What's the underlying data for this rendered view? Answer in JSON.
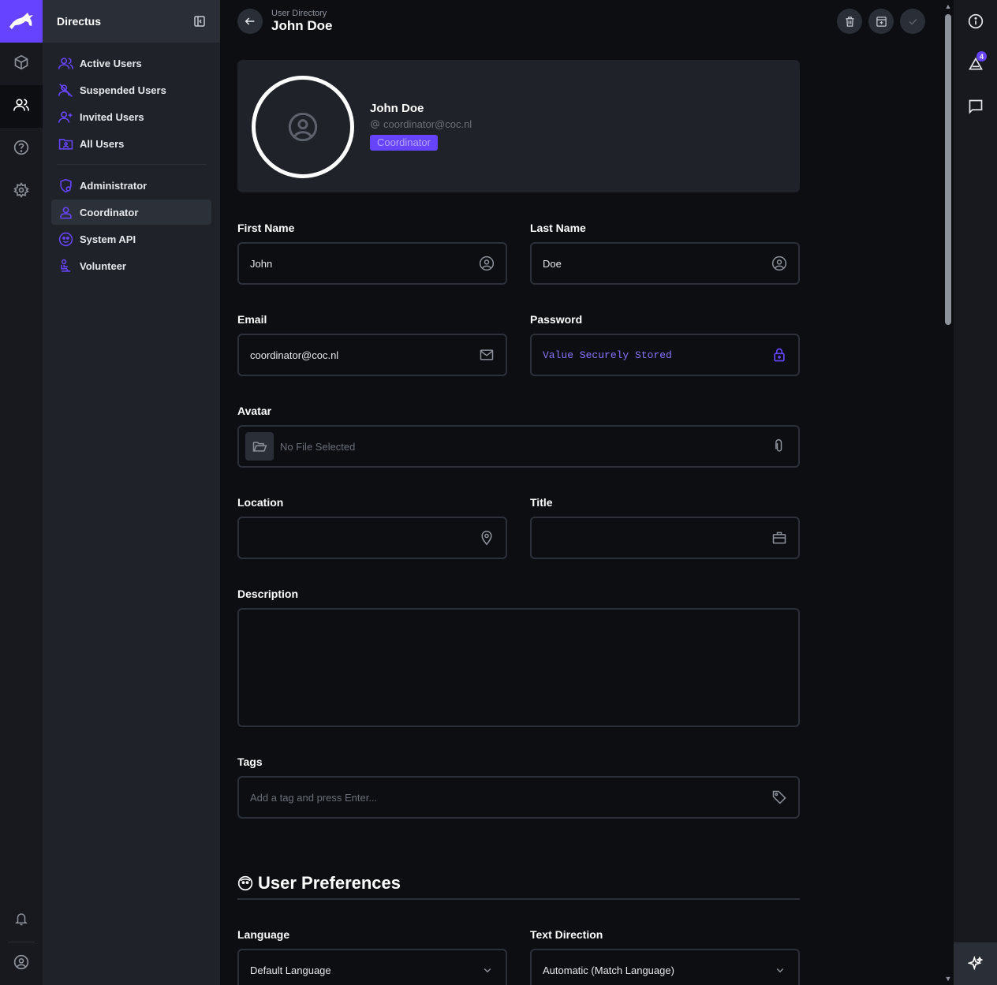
{
  "app": {
    "name": "Directus",
    "accent_color": "#6644ff"
  },
  "module_bar": {
    "items": [
      {
        "icon": "box-icon",
        "active": false
      },
      {
        "icon": "users-icon",
        "active": true
      },
      {
        "icon": "help-icon",
        "active": false
      },
      {
        "icon": "gear-icon",
        "active": false
      }
    ],
    "bottom": [
      {
        "icon": "bell-icon"
      },
      {
        "icon": "user-circle-icon"
      }
    ]
  },
  "nav": {
    "title": "Directus",
    "filters": [
      {
        "label": "Active Users",
        "icon": "users-icon"
      },
      {
        "label": "Suspended Users",
        "icon": "users-off-icon"
      },
      {
        "label": "Invited Users",
        "icon": "user-plus-icon"
      },
      {
        "label": "All Users",
        "icon": "folder-user-icon"
      }
    ],
    "roles": [
      {
        "label": "Administrator",
        "icon": "shield-user-icon",
        "active": false
      },
      {
        "label": "Coordinator",
        "icon": "user-icon",
        "active": true
      },
      {
        "label": "System API",
        "icon": "face-icon",
        "active": false
      },
      {
        "label": "Volunteer",
        "icon": "seated-user-icon",
        "active": false
      }
    ]
  },
  "header": {
    "breadcrumb": "User Directory",
    "title": "John Doe",
    "actions": [
      {
        "icon": "trash-icon"
      },
      {
        "icon": "archive-icon"
      },
      {
        "icon": "check-icon",
        "disabled": true
      }
    ]
  },
  "user_card": {
    "name": "John Doe",
    "email": "coordinator@coc.nl",
    "role": "Coordinator"
  },
  "form": {
    "first_name": {
      "label": "First Name",
      "value": "John"
    },
    "last_name": {
      "label": "Last Name",
      "value": "Doe"
    },
    "email": {
      "label": "Email",
      "value": "coordinator@coc.nl"
    },
    "password": {
      "label": "Password",
      "value": "Value Securely Stored"
    },
    "avatar": {
      "label": "Avatar",
      "placeholder": "No File Selected"
    },
    "location": {
      "label": "Location",
      "value": ""
    },
    "title": {
      "label": "Title",
      "value": ""
    },
    "description": {
      "label": "Description",
      "value": ""
    },
    "tags": {
      "label": "Tags",
      "placeholder": "Add a tag and press Enter..."
    }
  },
  "preferences": {
    "section_title": "User Preferences",
    "language": {
      "label": "Language",
      "value": "Default Language"
    },
    "text_direction": {
      "label": "Text Direction",
      "value": "Automatic (Match Language)"
    }
  },
  "sidebar": {
    "items": [
      {
        "icon": "info-icon"
      },
      {
        "icon": "revisions-icon",
        "badge": "4"
      },
      {
        "icon": "comment-icon"
      }
    ],
    "bottom_icon": "sparkle-icon"
  }
}
